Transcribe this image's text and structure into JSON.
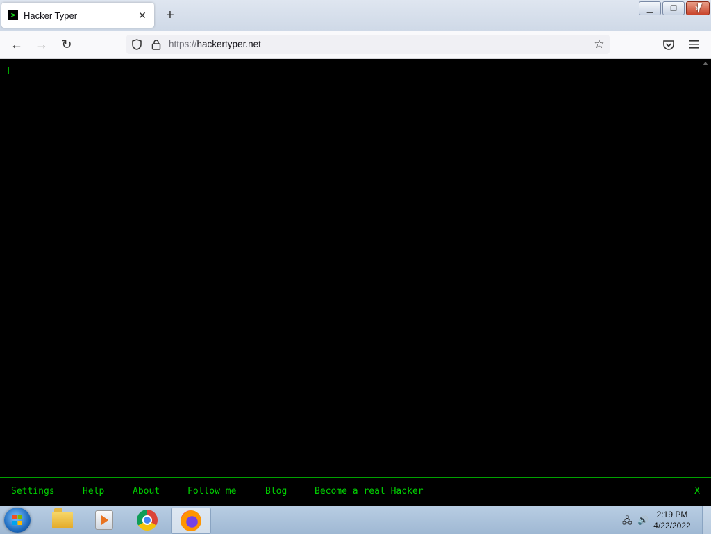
{
  "browser": {
    "tab": {
      "title": "Hacker Typer",
      "favicon": ">"
    },
    "new_tab_icon": "plus-icon",
    "url": {
      "protocol": "https://",
      "host": "hackertyper.net"
    }
  },
  "window_controls": {
    "minimize": "minimize-icon",
    "restore": "restore-icon",
    "close": "close-icon"
  },
  "page": {
    "footer_links": [
      "Settings",
      "Help",
      "About",
      "Follow me",
      "Blog",
      "Become a real Hacker"
    ],
    "close_label": "X",
    "colors": {
      "background": "#000000",
      "text": "#00d100",
      "border": "#00a100"
    }
  },
  "taskbar": {
    "apps": [
      "File Explorer",
      "Windows Media Player",
      "Google Chrome",
      "Firefox"
    ],
    "clock": {
      "time": "2:19 PM",
      "date": "4/22/2022"
    }
  }
}
